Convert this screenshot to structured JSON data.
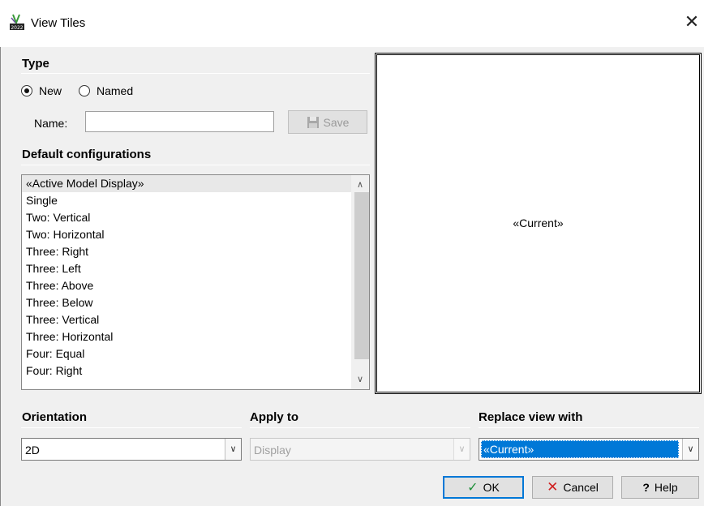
{
  "window": {
    "title": "View Tiles",
    "close_glyph": "✕",
    "icon": "app-icon"
  },
  "type_section": {
    "heading": "Type",
    "radio_new": "New",
    "radio_named": "Named",
    "selected": "New",
    "name_label": "Name:",
    "name_value": "",
    "save_label": "Save"
  },
  "configs": {
    "heading": "Default configurations",
    "items": [
      "«Active Model Display»",
      "Single",
      "Two: Vertical",
      "Two: Horizontal",
      "Three: Right",
      "Three: Left",
      "Three: Above",
      "Three: Below",
      "Three: Vertical",
      "Three: Horizontal",
      "Four: Equal",
      "Four: Right"
    ],
    "selected_index": 0
  },
  "preview": {
    "label": "«Current»"
  },
  "orientation": {
    "heading": "Orientation",
    "value": "2D"
  },
  "apply_to": {
    "heading": "Apply to",
    "value": "Display"
  },
  "replace_view": {
    "heading": "Replace view with",
    "value": "«Current»"
  },
  "buttons": {
    "ok": "OK",
    "cancel": "Cancel",
    "help": "Help"
  },
  "colors": {
    "accent": "#0078d7",
    "ok_icon": "#1f8f3a",
    "cancel_icon": "#d02020"
  }
}
